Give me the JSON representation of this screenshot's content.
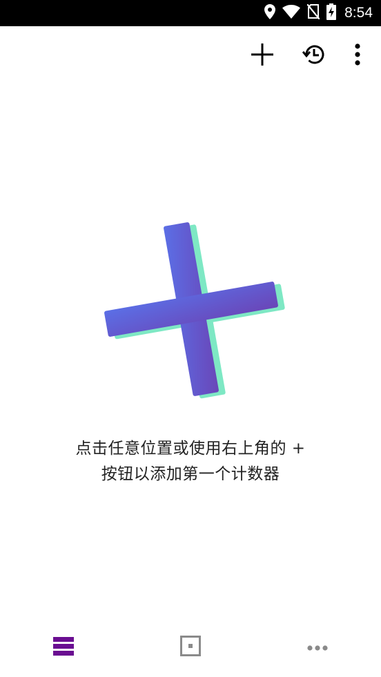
{
  "status_bar": {
    "time": "8:54",
    "icons": [
      "location-icon",
      "wifi-icon",
      "no-sim-icon",
      "battery-charging-icon"
    ]
  },
  "toolbar": {
    "actions": [
      "add-icon",
      "history-icon",
      "more-vert-icon"
    ]
  },
  "empty_state": {
    "line1": "点击任意位置或使用右上角的 +",
    "line2": "按钮以添加第一个计数器"
  },
  "bottom_nav": {
    "items": [
      "counters-list-icon",
      "single-counter-icon",
      "more-horiz-icon"
    ],
    "active_color": "#6a0d91",
    "inactive_color": "#8a8a8a"
  },
  "colors": {
    "plus_gradient_start": "#5b6fe6",
    "plus_gradient_end": "#6a46b8",
    "plus_shadow": "#7ee8c4"
  }
}
